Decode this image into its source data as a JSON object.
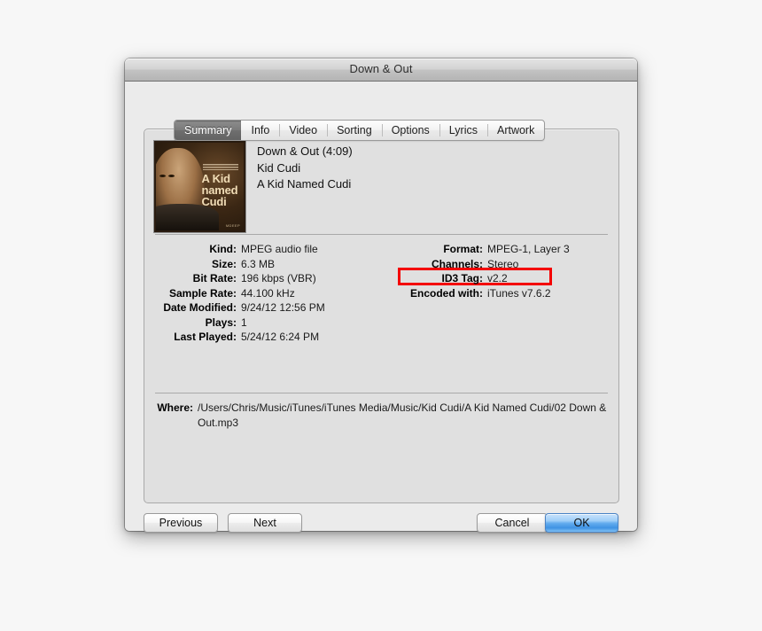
{
  "window": {
    "title": "Down & Out"
  },
  "tabs": [
    {
      "label": "Summary",
      "selected": true
    },
    {
      "label": "Info",
      "selected": false
    },
    {
      "label": "Video",
      "selected": false
    },
    {
      "label": "Sorting",
      "selected": false
    },
    {
      "label": "Options",
      "selected": false
    },
    {
      "label": "Lyrics",
      "selected": false
    },
    {
      "label": "Artwork",
      "selected": false
    }
  ],
  "media": {
    "artwork_text": {
      "line1": "A Kid",
      "line2": "named",
      "line3": "Cudi",
      "label": "MDEEP"
    },
    "track_title": "Down & Out (4:09)",
    "artist": "Kid Cudi",
    "album": "A Kid Named Cudi"
  },
  "details_left": [
    {
      "label": "Kind:",
      "value": "MPEG audio file"
    },
    {
      "label": "Size:",
      "value": "6.3 MB"
    },
    {
      "label": "Bit Rate:",
      "value": "196 kbps (VBR)"
    },
    {
      "label": "Sample Rate:",
      "value": "44.100 kHz"
    },
    {
      "label": "Date Modified:",
      "value": "9/24/12 12:56 PM"
    },
    {
      "label": "Plays:",
      "value": "1"
    },
    {
      "label": "Last Played:",
      "value": "5/24/12 6:24 PM"
    }
  ],
  "details_right": [
    {
      "label": "Format:",
      "value": "MPEG-1, Layer 3"
    },
    {
      "label": "Channels:",
      "value": "Stereo"
    },
    {
      "label": "ID3 Tag:",
      "value": "v2.2",
      "highlighted": true
    },
    {
      "label": "Encoded with:",
      "value": "iTunes v7.6.2"
    }
  ],
  "where": {
    "label": "Where:",
    "value": "/Users/Chris/Music/iTunes/iTunes Media/Music/Kid Cudi/A Kid Named Cudi/02 Down & Out.mp3"
  },
  "buttons": {
    "previous": "Previous",
    "next": "Next",
    "cancel": "Cancel",
    "ok": "OK"
  },
  "colors": {
    "highlight": "#f40000",
    "default_button": "#3f93e4",
    "selected_tab": "#6f6f6f"
  }
}
